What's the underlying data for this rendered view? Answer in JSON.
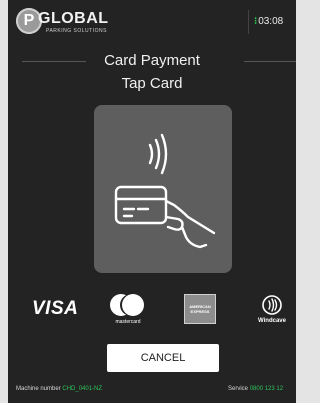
{
  "header": {
    "brand_name": "GLOBAL",
    "brand_tagline": "PARKING SOLUTIONS",
    "brand_badge": "P",
    "time": "03:08",
    "time_indicator": "⁝"
  },
  "screen": {
    "title": "Card Payment",
    "subtitle": "Tap Card"
  },
  "payment_logos": {
    "visa": "VISA",
    "mastercard": "mastercard",
    "amex": "AMERICAN EXPRESS",
    "windcave": "Windcave"
  },
  "actions": {
    "cancel_label": "CANCEL"
  },
  "footer": {
    "machine_label": "Machine number",
    "machine_value": "CHD_0401-NZ",
    "service_label": "Service",
    "service_value": "0800 123 12"
  },
  "colors": {
    "background": "#232323",
    "panel": "#5e5e5e",
    "accent_green": "#2dc45a",
    "button": "#ffffff"
  },
  "icons": [
    "contactless-card-tap-icon",
    "windcave-contactless-icon"
  ]
}
